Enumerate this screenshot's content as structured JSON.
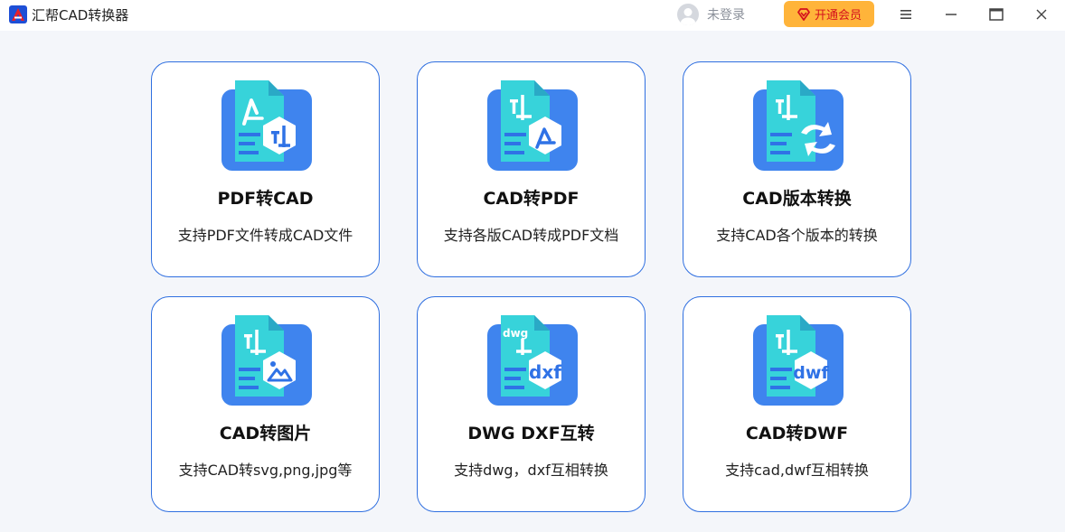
{
  "app": {
    "title": "汇帮CAD转换器",
    "logo_icon": "cad-logo-icon",
    "accent_color": "#2f6fe0"
  },
  "header": {
    "user_label": "未登录",
    "vip_label": "开通会员",
    "vip_color": "#ffb43a"
  },
  "cards": [
    {
      "title": "PDF转CAD",
      "desc": "支持PDF文件转成CAD文件",
      "icon": "pdf-to-cad-icon"
    },
    {
      "title": "CAD转PDF",
      "desc": "支持各版CAD转成PDF文档",
      "icon": "cad-to-pdf-icon"
    },
    {
      "title": "CAD版本转换",
      "desc": "支持CAD各个版本的转换",
      "icon": "cad-version-convert-icon"
    },
    {
      "title": "CAD转图片",
      "desc": "支持CAD转svg,png,jpg等",
      "icon": "cad-to-image-icon"
    },
    {
      "title": "DWG DXF互转",
      "desc": "支持dwg，dxf互相转换",
      "icon": "dwg-dxf-convert-icon",
      "badge_top": "dwg",
      "badge": "dxf"
    },
    {
      "title": "CAD转DWF",
      "desc": "支持cad,dwf互相转换",
      "icon": "cad-to-dwf-icon",
      "badge": "dwf"
    }
  ]
}
